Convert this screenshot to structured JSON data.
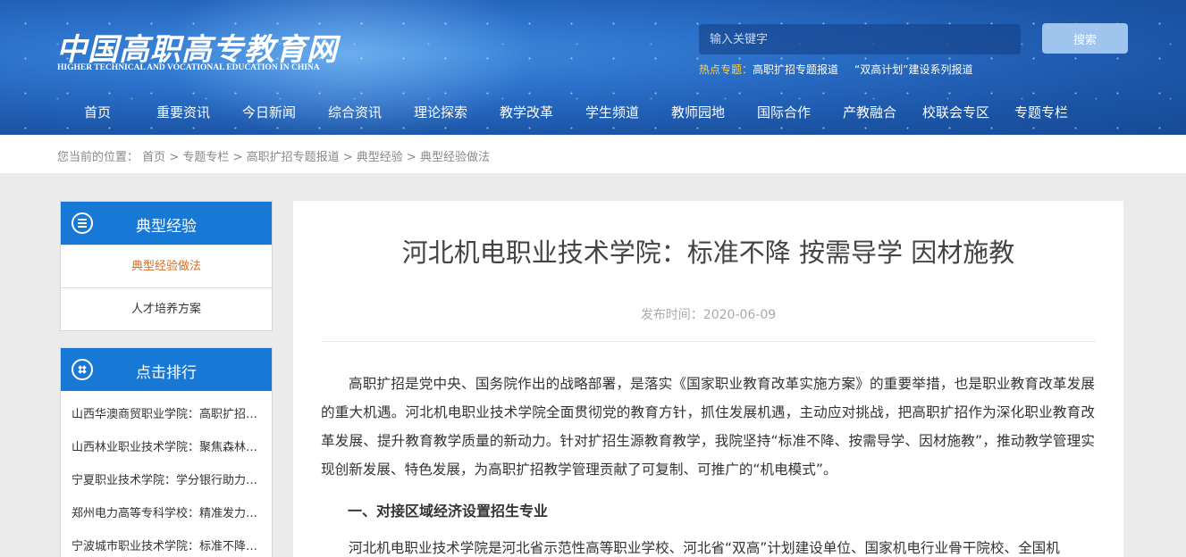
{
  "site": {
    "logo_cn": "中国高职高专教育网",
    "logo_en": "HIGHER TECHNICAL AND VOCATIONAL EDUCATION IN CHINA"
  },
  "search": {
    "placeholder": "输入关键字",
    "button": "搜索"
  },
  "hot": {
    "label": "热点专题：",
    "links": [
      "高职扩招专题报道",
      "“双高计划”建设系列报道"
    ]
  },
  "nav": [
    "首页",
    "重要资讯",
    "今日新闻",
    "综合资讯",
    "理论探索",
    "教学改革",
    "学生频道",
    "教师园地",
    "国际合作",
    "产教融合",
    "校联会专区",
    "专题专栏"
  ],
  "breadcrumb": {
    "label": "您当前的位置：",
    "items": [
      "首页",
      "专题专栏",
      "高职扩招专题报道",
      "典型经验",
      "典型经验做法"
    ],
    "sep": ">"
  },
  "sidebar": {
    "section1": {
      "title": "典型经验",
      "items": [
        "典型经验做法",
        "人才培养方案"
      ]
    },
    "section2": {
      "title": "点击排行",
      "items": [
        "山西华澳商贸职业学院：高职扩招…",
        "山西林业职业技术学院：聚焦森林…",
        "宁夏职业技术学院：学分银行助力…",
        "郑州电力高等专科学校：精准发力…",
        "宁波城市职业技术学院：标准不降…"
      ]
    }
  },
  "article": {
    "title": "河北机电职业技术学院：标准不降 按需导学 因材施教",
    "date": "发布时间：2020-06-09",
    "para1": "高职扩招是党中央、国务院作出的战略部署，是落实《国家职业教育改革实施方案》的重要举措，也是职业教育改革发展的重大机遇。河北机电职业技术学院全面贯彻党的教育方针，抓住发展机遇，主动应对挑战，把高职扩招作为深化职业教育改革发展、提升教育教学质量的新动力。针对扩招生源教育教学，我院坚持“标准不降、按需导学、因材施教”，推动教学管理实现创新发展、特色发展，为高职扩招教学管理贡献了可复制、可推广的“机电模式”。",
    "subheading": "一、对接区域经济设置招生专业",
    "para2": "河北机电职业技术学院是河北省示范性高等职业学校、河北省“双高”计划建设单位、国家机电行业骨干院校、全国机"
  }
}
